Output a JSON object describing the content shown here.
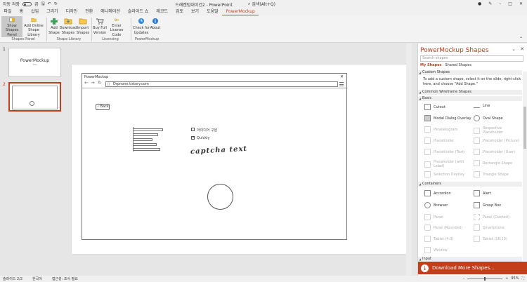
{
  "titlebar": {
    "autosave_label": "자동 저장",
    "toggle_state": "끔",
    "doc_title": "드래캔텀대이건2  -  PowerPoint",
    "search_placeholder": "검색(Alt+Q)"
  },
  "menu": [
    "파일",
    "홈",
    "삽입",
    "그리기",
    "디자인",
    "전환",
    "애니메이션",
    "슬라이드 쇼",
    "레코드",
    "검토",
    "보기",
    "도움말",
    "PowerMockup"
  ],
  "menu_active": "PowerMockup",
  "ribbon": {
    "buttons": {
      "show": "Show Shapes Panel",
      "addonline": "Add Online Shape Library",
      "addshape": "Add Shape",
      "download": "Download Shapes",
      "import": "Import Shapes",
      "buyfull": "Buy Full Version",
      "enterlic": "Enter License Code",
      "check": "Check for Updates",
      "about": "About"
    },
    "groups": {
      "panel": "Shapes Panel",
      "library": "Shape Library",
      "licensing": "Licensing",
      "pm": "PowerMockup"
    }
  },
  "slides": [
    {
      "number": "1",
      "title": "PowerMockup",
      "subtitle": "Title"
    },
    {
      "number": "2"
    }
  ],
  "mockup": {
    "window_title": "PowerMockup",
    "url": "Drpnone.tistory.com",
    "back_label": "Back",
    "check1_label": "아이디어 구원",
    "check2_label": "Quickly",
    "captcha_text": "captcha text"
  },
  "pane": {
    "title": "PowerMockup Shapes",
    "search_placeholder": "Search shapes",
    "tab_my": "My Shapes",
    "tab_shared": "Shared Shapes",
    "sec_custom": "Custom Shapes",
    "custom_help": "To add a custom shape, select it on the slide, right-click here, and choose \"Add Shape.\"",
    "sec_common": "Common Wireframe Shapes",
    "sec_basic": "Basic",
    "basic": [
      {
        "name": "Cutout",
        "enabled": true
      },
      {
        "name": "Line",
        "enabled": true
      },
      {
        "name": "Modal Dialog Overlay",
        "enabled": true
      },
      {
        "name": "Oval Shape",
        "enabled": true
      },
      {
        "name": "Parallelogram",
        "enabled": false
      },
      {
        "name": "Respective Placeholder",
        "enabled": false
      },
      {
        "name": "Placeholder",
        "enabled": false
      },
      {
        "name": "Placeholder (Picture)",
        "enabled": false
      },
      {
        "name": "Placeholder (Text)",
        "enabled": false
      },
      {
        "name": "Placeholder (User)",
        "enabled": false
      },
      {
        "name": "Placeholder (with Label)",
        "enabled": false
      },
      {
        "name": "Rectangle Shape",
        "enabled": false
      },
      {
        "name": "Selection Overlay",
        "enabled": false
      },
      {
        "name": "Triangle Shape",
        "enabled": false
      }
    ],
    "sec_containers": "Containers",
    "containers": [
      {
        "name": "Accordion",
        "enabled": true
      },
      {
        "name": "Alert",
        "enabled": true
      },
      {
        "name": "Browser",
        "enabled": true
      },
      {
        "name": "Group Box",
        "enabled": true
      },
      {
        "name": "Panel",
        "enabled": false
      },
      {
        "name": "Panel (Dashed)",
        "enabled": false
      },
      {
        "name": "Panel (Rounded)",
        "enabled": false
      },
      {
        "name": "Smartphone",
        "enabled": false
      },
      {
        "name": "Tablet (4:3)",
        "enabled": false
      },
      {
        "name": "Tablet (16:10)",
        "enabled": false
      },
      {
        "name": "Window",
        "enabled": false
      }
    ],
    "sec_input": "Input",
    "download_label": "Download More Shapes..."
  },
  "status": {
    "slide_count": "슬라이드 2/2",
    "language": "한국어",
    "accessibility": "접근성: 조사 필요",
    "zoom": "95%"
  },
  "colors": {
    "accent": "#c43e1c"
  }
}
